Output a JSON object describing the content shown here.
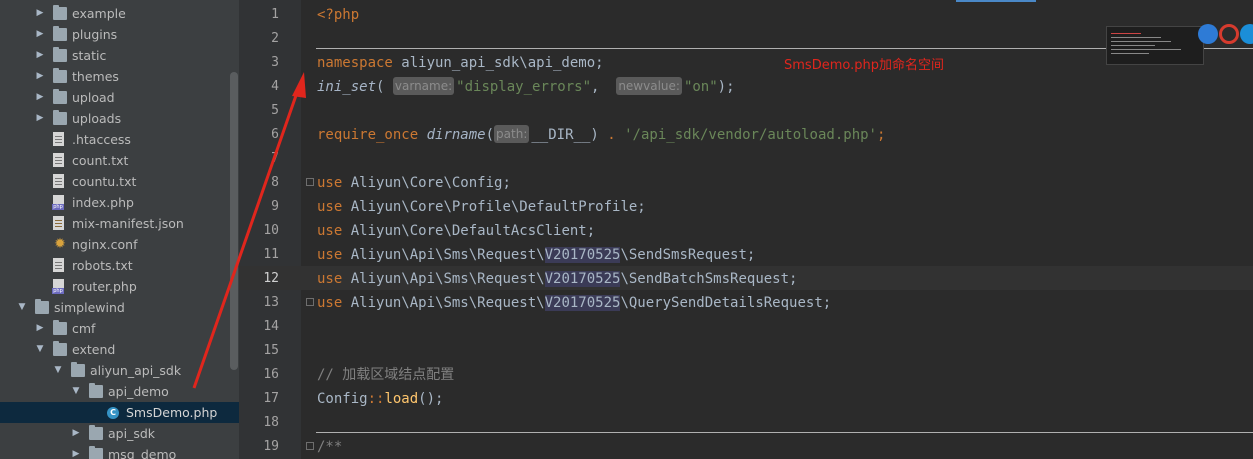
{
  "sidebar": {
    "items": [
      {
        "label": "example",
        "type": "folder",
        "depth": 2,
        "expanded": false
      },
      {
        "label": "plugins",
        "type": "folder",
        "depth": 2,
        "expanded": false
      },
      {
        "label": "static",
        "type": "folder",
        "depth": 2,
        "expanded": false
      },
      {
        "label": "themes",
        "type": "folder",
        "depth": 2,
        "expanded": false
      },
      {
        "label": "upload",
        "type": "folder",
        "depth": 2,
        "expanded": false
      },
      {
        "label": "uploads",
        "type": "folder",
        "depth": 2,
        "expanded": false
      },
      {
        "label": ".htaccess",
        "type": "file-txt",
        "depth": 2
      },
      {
        "label": "count.txt",
        "type": "file-txt",
        "depth": 2
      },
      {
        "label": "countu.txt",
        "type": "file-txt",
        "depth": 2
      },
      {
        "label": "index.php",
        "type": "file-php",
        "depth": 2
      },
      {
        "label": "mix-manifest.json",
        "type": "file-json",
        "depth": 2
      },
      {
        "label": "nginx.conf",
        "type": "file-conf",
        "depth": 2
      },
      {
        "label": "robots.txt",
        "type": "file-txt",
        "depth": 2
      },
      {
        "label": "router.php",
        "type": "file-php",
        "depth": 2
      },
      {
        "label": "simplewind",
        "type": "folder",
        "depth": 1,
        "expanded": true
      },
      {
        "label": "cmf",
        "type": "folder",
        "depth": 2,
        "expanded": false
      },
      {
        "label": "extend",
        "type": "folder",
        "depth": 2,
        "expanded": true
      },
      {
        "label": "aliyun_api_sdk",
        "type": "folder",
        "depth": 3,
        "expanded": true
      },
      {
        "label": "api_demo",
        "type": "folder",
        "depth": 4,
        "expanded": true
      },
      {
        "label": "SmsDemo.php",
        "type": "file-class",
        "depth": 5,
        "selected": true
      },
      {
        "label": "api_sdk",
        "type": "folder",
        "depth": 4,
        "expanded": false
      },
      {
        "label": "msg_demo",
        "type": "folder",
        "depth": 4,
        "expanded": false
      }
    ]
  },
  "editor": {
    "line_numbers": [
      "1",
      "2",
      "3",
      "4",
      "5",
      "6",
      "7",
      "8",
      "9",
      "10",
      "11",
      "12",
      "13",
      "14",
      "15",
      "16",
      "17",
      "18",
      "19"
    ],
    "current_line": "12",
    "lines": {
      "l1": {
        "tag": "<?php"
      },
      "l3": {
        "kw": "namespace",
        "rest": " aliyun_api_sdk\\api_demo;"
      },
      "l4": {
        "fn": "ini_set",
        "open": "(",
        "hint1": "varname:",
        "arg1": "\"display_errors\"",
        "comma": ", ",
        "hint2": "newvalue:",
        "arg2": "\"on\"",
        "close": ");"
      },
      "l6": {
        "kw": "require_once",
        "fn": "dirname",
        "open": "(",
        "hint": "path:",
        "arg": "__DIR__",
        "close": ")",
        "dot": " . ",
        "str": "'/api_sdk/vendor/autoload.php'",
        "semi": ";"
      },
      "l8": {
        "kw": "use",
        "rest": " Aliyun\\Core\\Config;"
      },
      "l9": {
        "kw": "use",
        "rest": " Aliyun\\Core\\Profile\\DefaultProfile;"
      },
      "l10": {
        "kw": "use",
        "rest": " Aliyun\\Core\\DefaultAcsClient;"
      },
      "l11": {
        "kw": "use",
        "pre": " Aliyun\\Api\\Sms\\Request\\",
        "ver": "V20170525",
        "post": "\\SendSmsRequest;"
      },
      "l12": {
        "kw": "use",
        "pre": " Aliyun\\Api\\Sms\\Request\\",
        "ver": "V20170525",
        "post": "\\SendBatchSmsRequest;"
      },
      "l13": {
        "kw": "use",
        "pre": " Aliyun\\Api\\Sms\\Request\\",
        "ver": "V20170525",
        "post": "\\QuerySendDetailsRequest;"
      },
      "l16": {
        "comment": "// 加载区域结点配置"
      },
      "l17": {
        "cls": "Config",
        "op": "::",
        "fn": "load",
        "rest": "();"
      },
      "l19": {
        "comment": "/**"
      }
    }
  },
  "annotation": {
    "text": "SmsDemo.php加命名空间",
    "color": "#e0261d"
  },
  "colors": {
    "keyword": "#cc7832",
    "function": "#ffc66d",
    "string": "#6a8759",
    "comment": "#808080",
    "background": "#2b2b2b",
    "sidebar": "#3c3f41",
    "selection": "#0d293e",
    "annotation": "#e0261d"
  }
}
